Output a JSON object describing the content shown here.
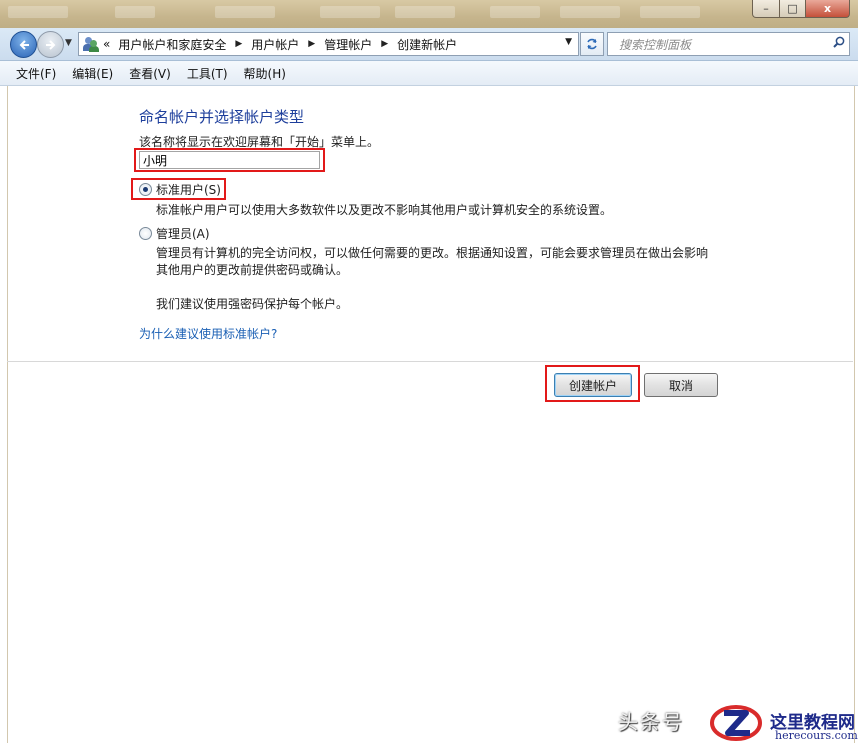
{
  "address_bar": {
    "overflow_chevron": "«",
    "breadcrumbs": [
      "用户帐户和家庭安全",
      "用户帐户",
      "管理帐户",
      "创建新帐户"
    ],
    "search_placeholder": "搜索控制面板"
  },
  "menu": [
    "文件(F)",
    "编辑(E)",
    "查看(V)",
    "工具(T)",
    "帮助(H)"
  ],
  "form": {
    "heading": "命名帐户并选择帐户类型",
    "name_hint": "该名称将显示在欢迎屏幕和「开始」菜单上。",
    "name_value": "小明",
    "standard": {
      "label": "标准用户(S)",
      "selected": true,
      "description": "标准帐户用户可以使用大多数软件以及更改不影响其他用户或计算机安全的系统设置。"
    },
    "admin": {
      "label": "管理员(A)",
      "selected": false,
      "description_line1": "管理员有计算机的完全访问权，可以做任何需要的更改。根据通知设置，可能会要求管理员在做出会影响",
      "description_line2": "其他用户的更改前提供密码或确认。",
      "recommendation": "我们建议使用强密码保护每个帐户。"
    },
    "help_link": "为什么建议使用标准帐户?"
  },
  "buttons": {
    "create": "创建帐户",
    "cancel": "取消"
  },
  "window_buttons": {
    "minimize": "–",
    "maximize": "□",
    "close": "x"
  },
  "watermark": {
    "platform": "头条号",
    "site_title": "这里教程网",
    "site_url": "herecours.com"
  },
  "colors": {
    "highlight_box": "#e21919",
    "heading": "#1e3f9c",
    "link": "#1a5fb4"
  },
  "icons": [
    "back-arrow-icon",
    "forward-arrow-icon",
    "users-icon",
    "refresh-icon",
    "search-icon",
    "radio-button"
  ]
}
